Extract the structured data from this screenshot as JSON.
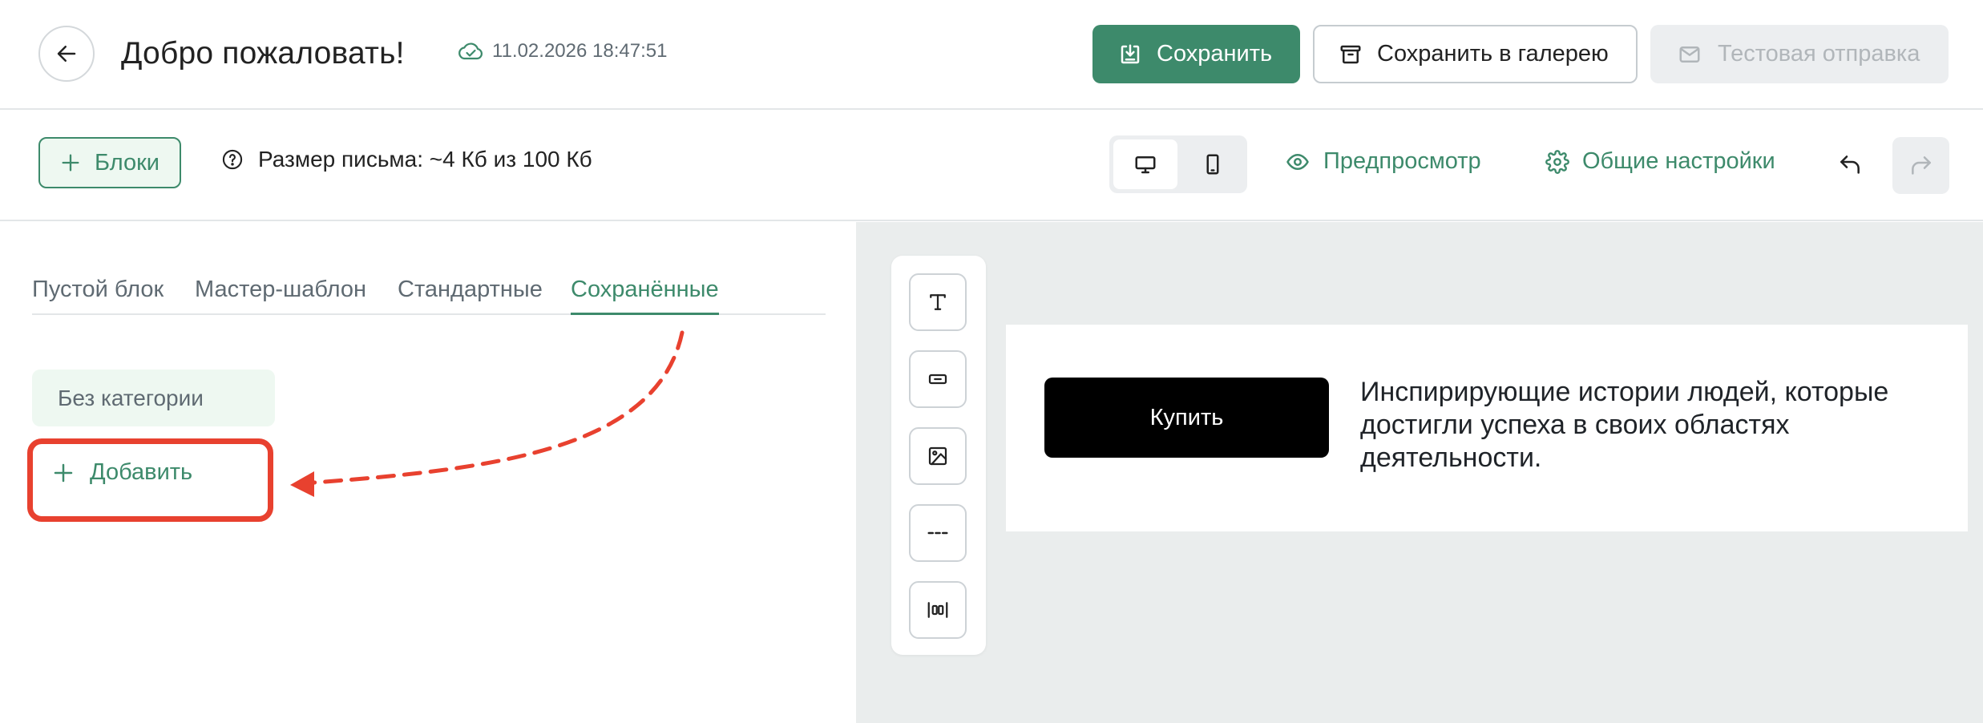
{
  "header": {
    "title": "Добро пожаловать!",
    "save_status": "11.02.2026 18:47:51",
    "save_button": "Сохранить",
    "gallery_button": "Сохранить в галерею",
    "test_send_button": "Тестовая отправка"
  },
  "toolbar": {
    "blocks_button": "Блоки",
    "size_info": "Размер письма: ~4 Кб из 100 Кб",
    "preview_link": "Предпросмотр",
    "settings_link": "Общие настройки"
  },
  "blocks_panel": {
    "tabs": [
      {
        "label": "Пустой блок",
        "active": false
      },
      {
        "label": "Мастер-шаблон",
        "active": false
      },
      {
        "label": "Стандартные",
        "active": false
      },
      {
        "label": "Сохранённые",
        "active": true
      }
    ],
    "category": "Без категории",
    "add_button": "Добавить"
  },
  "canvas": {
    "tools": [
      "text-icon",
      "button-icon",
      "image-icon",
      "divider-icon",
      "spacer-icon"
    ],
    "email_block": {
      "button_label": "Купить",
      "text": "Инспирирующие истории людей, которые достигли успеха в своих областях деятельности."
    }
  },
  "colors": {
    "accent": "#3d8a6b",
    "accent_light": "#eef8f1",
    "highlight": "#e8412f",
    "canvas_bg": "#eaeded",
    "disabled_bg": "#eceef0"
  }
}
